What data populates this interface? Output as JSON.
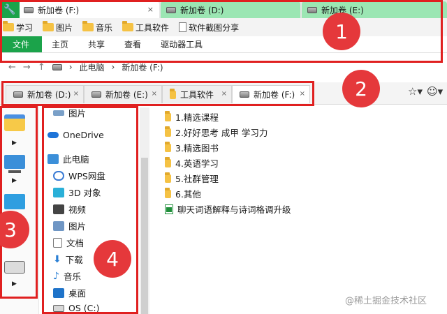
{
  "window_tabs": [
    {
      "label": "新加卷 (F:)",
      "close": "×"
    },
    {
      "label": "新加卷 (D:)",
      "close": ""
    },
    {
      "label": "新加卷 (E:)",
      "close": ""
    }
  ],
  "bookmarks": [
    {
      "label": "学习",
      "icon": "folder-icon"
    },
    {
      "label": "图片",
      "icon": "folder-icon"
    },
    {
      "label": "音乐",
      "icon": "folder-icon"
    },
    {
      "label": "工具软件",
      "icon": "folder-icon"
    },
    {
      "label": "软件截图分享",
      "icon": "document-icon"
    }
  ],
  "ribbon_tabs": [
    "文件",
    "主页",
    "共享",
    "查看",
    "驱动器工具"
  ],
  "address": {
    "back": "←",
    "forward": "→",
    "up": "↑",
    "path": [
      "此电脑",
      "新加卷 (F:)"
    ],
    "sep": "›"
  },
  "folder_tabs": [
    {
      "label": "新加卷 (D:)",
      "close": "×"
    },
    {
      "label": "新加卷 (E:)",
      "close": "×"
    },
    {
      "label": "工具软件",
      "close": "×"
    },
    {
      "label": "新加卷 (F:)",
      "close": "×"
    }
  ],
  "toolbar_icons": {
    "star": "☆▾",
    "smile": "☺▾"
  },
  "nav": {
    "top_partial": "图片",
    "items": [
      {
        "label": "OneDrive",
        "icon": "onedrive-icon"
      },
      {
        "label": "此电脑",
        "icon": "this-pc-icon"
      },
      {
        "label": "WPS网盘",
        "icon": "wps-cloud-icon"
      },
      {
        "label": "3D 对象",
        "icon": "3d-objects-icon"
      },
      {
        "label": "视频",
        "icon": "video-icon"
      },
      {
        "label": "图片",
        "icon": "pictures-icon"
      },
      {
        "label": "文档",
        "icon": "documents-icon"
      },
      {
        "label": "下载",
        "icon": "download-icon"
      },
      {
        "label": "音乐",
        "icon": "music-icon"
      },
      {
        "label": "桌面",
        "icon": "desktop-icon"
      },
      {
        "label": "OS (C:)",
        "icon": "os-drive-icon"
      }
    ]
  },
  "files": [
    {
      "name": "1.精选课程",
      "type": "folder"
    },
    {
      "name": "2.好好思考 成甲 学习力",
      "type": "folder"
    },
    {
      "name": "3.精选图书",
      "type": "folder"
    },
    {
      "name": "4.英语学习",
      "type": "folder"
    },
    {
      "name": "5.社群管理",
      "type": "folder"
    },
    {
      "name": "6.其他",
      "type": "folder"
    },
    {
      "name": "聊天词语解释与诗词格调升级",
      "type": "excel"
    }
  ],
  "annotations": [
    "1",
    "2",
    "3",
    "4"
  ],
  "watermark": "@稀土掘金技术社区",
  "colors": {
    "accent_green": "#1ba34a",
    "annotation_red": "#e02020",
    "folder_yellow": "#f5c244"
  }
}
